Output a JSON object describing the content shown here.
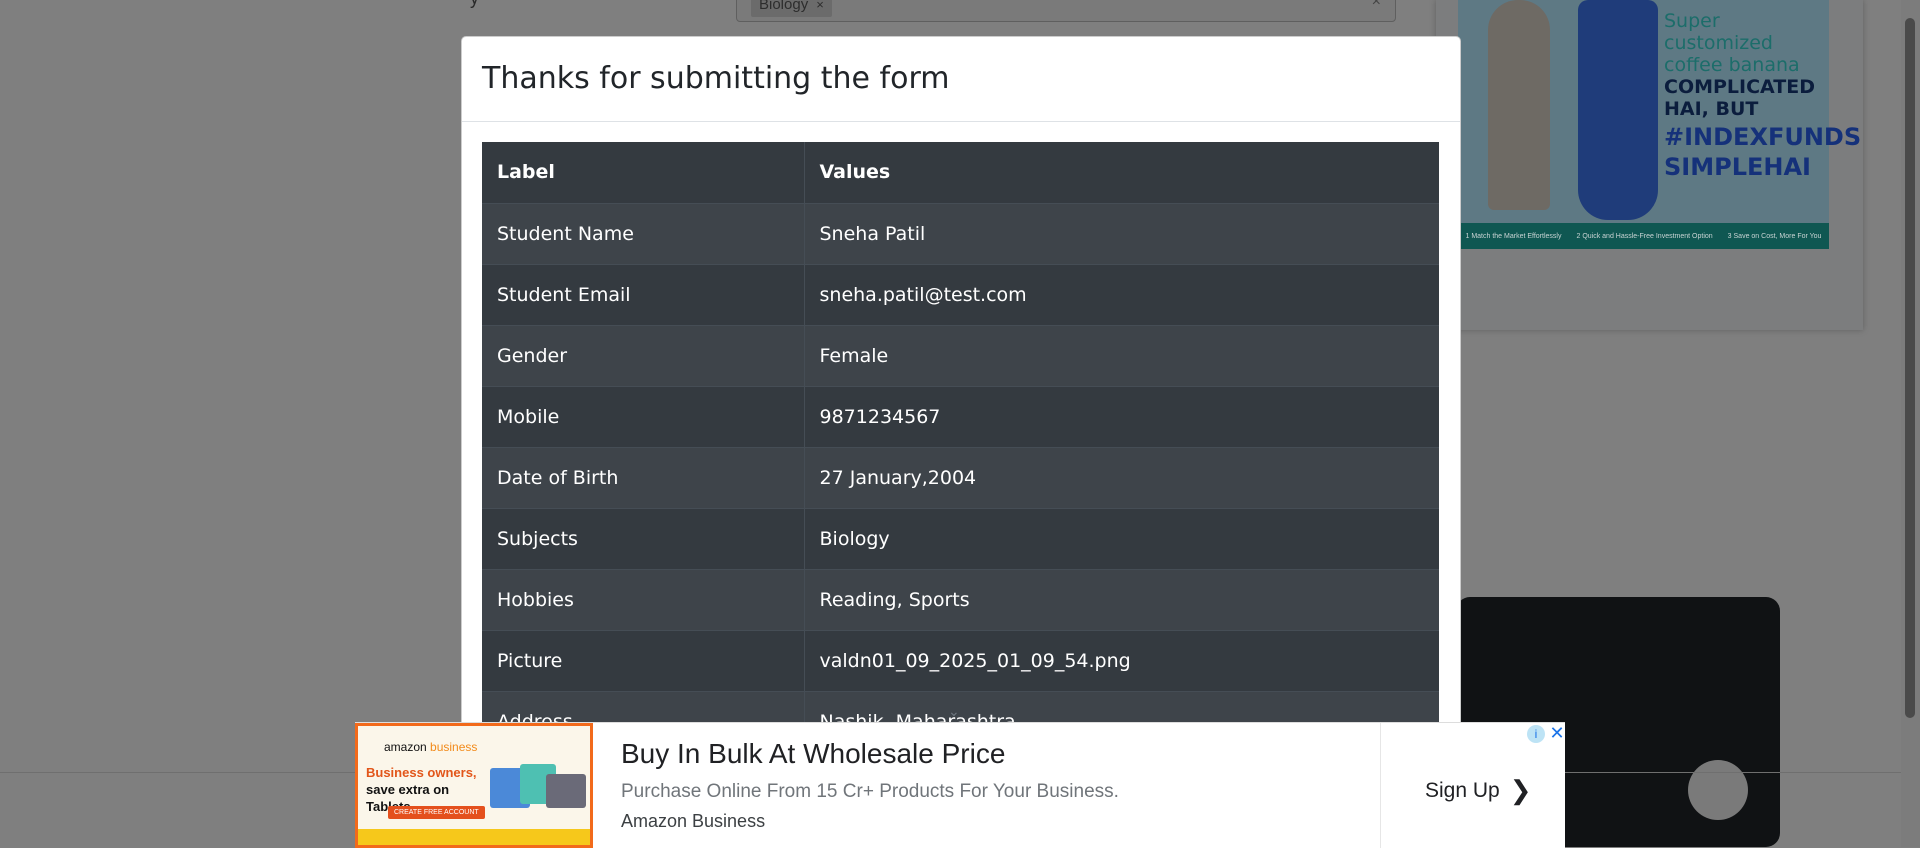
{
  "background": {
    "partial_label": "y",
    "subjects_chip": "Biology",
    "chip_remove": "×",
    "clear": "×",
    "side_ad": {
      "line1": "Super customized coffee banana",
      "line2": "COMPLICATED HAI, BUT",
      "line3": "#INDEXFUNDS SIMPLEHAI",
      "steps": [
        "1 Match the Market Effortlessly",
        "2 Quick and Hassle-Free Investment Option",
        "3 Save on Cost, More For You"
      ]
    }
  },
  "modal": {
    "title": "Thanks for submitting the form",
    "table": {
      "headers": [
        "Label",
        "Values"
      ],
      "rows": [
        [
          "Student Name",
          "Sneha Patil"
        ],
        [
          "Student Email",
          "sneha.patil@test.com"
        ],
        [
          "Gender",
          "Female"
        ],
        [
          "Mobile",
          "9871234567"
        ],
        [
          "Date of Birth",
          "27 January,2004"
        ],
        [
          "Subjects",
          "Biology"
        ],
        [
          "Hobbies",
          "Reading, Sports"
        ],
        [
          "Picture",
          "valdn01_09_2025_01_09_54.png"
        ],
        [
          "Address",
          "Nashik, Maharashtra"
        ]
      ]
    },
    "scroll_hint": "⌄"
  },
  "bottom_ad": {
    "thumb": {
      "brand_a": "amazon",
      "brand_b": "business",
      "headline1": "Business owners,",
      "headline2": "save extra on Tablets",
      "cta": "CREATE FREE ACCOUNT"
    },
    "title": "Buy In Bulk At Wholesale Price",
    "description": "Purchase Online From 15 Cr+ Products For Your Business.",
    "advertiser": "Amazon Business",
    "cta": "Sign Up",
    "cta_chevron": "❯",
    "info": "i",
    "close": "✕"
  }
}
